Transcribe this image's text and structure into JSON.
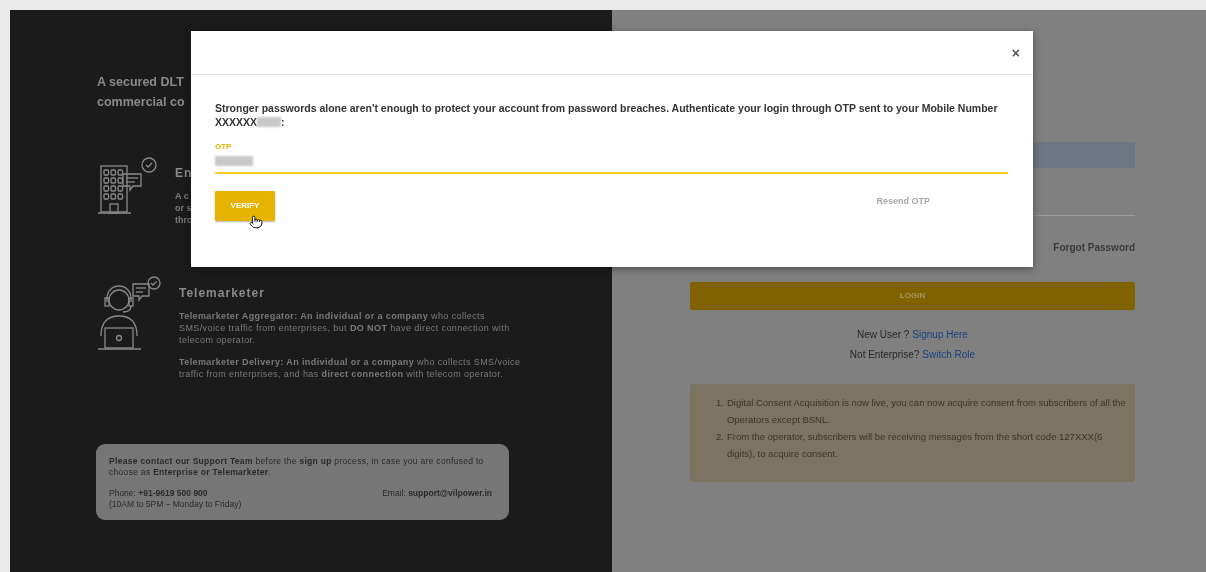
{
  "intro": {
    "heading_lines": [
      "A secured DLT",
      "commercial co"
    ]
  },
  "roles": [
    {
      "kind": "enterprise",
      "title": "En",
      "description_lines": [
        "A c",
        "or s",
        "thro"
      ]
    },
    {
      "kind": "telemarketer",
      "title": "Telemarketer",
      "paragraphs": [
        "**Telemarketer Aggregator: An individual or a company** who collects SMS/voice traffic from enterprises, but **DO NOT** have direct connection with telecom operator.",
        "**Telemarketer Delivery: An individual or a company** who collects SMS/voice traffic from enterprises, and has **direct connection** with  telecom operator."
      ]
    }
  ],
  "support": {
    "message": "**Please contact our Support Team** before the **sign up** process, in case you are confused to choose as **Enterprise or Telemarketer**.",
    "phone": "Phone: **+91-9619 500 900**",
    "hours": "(10AM to 5PM – Monday to Friday)",
    "email": "Email: **support@vilpower.in**"
  },
  "login": {
    "forgot": "Forgot Password",
    "button": "LOGIN",
    "signup_prompt": "New User ?",
    "signup_link": "Signup Here",
    "role_prompt": "Not Enterprise?",
    "role_link": "Switch Role"
  },
  "notices": [
    {
      "number": "1.",
      "text": "Digital Consent Acquisition is now live, you can now acquire consent from subscribers of all the Operators except BSNL."
    },
    {
      "number": "2.",
      "text": "From the operator, subscribers will be receiving messages from the short code 127XXX(6 digits), to acquire consent."
    }
  ],
  "modal": {
    "close": "×",
    "message": "Stronger passwords alone aren't enough to protect your account from password breaches. Authenticate your login through OTP sent to your Mobile Number",
    "mobile": "XXXXXX",
    "message_end": ":",
    "otp": {
      "label": "OTP"
    },
    "verify": "VERIFY",
    "resend": "Resend OTP",
    "resend_disabled": true
  }
}
